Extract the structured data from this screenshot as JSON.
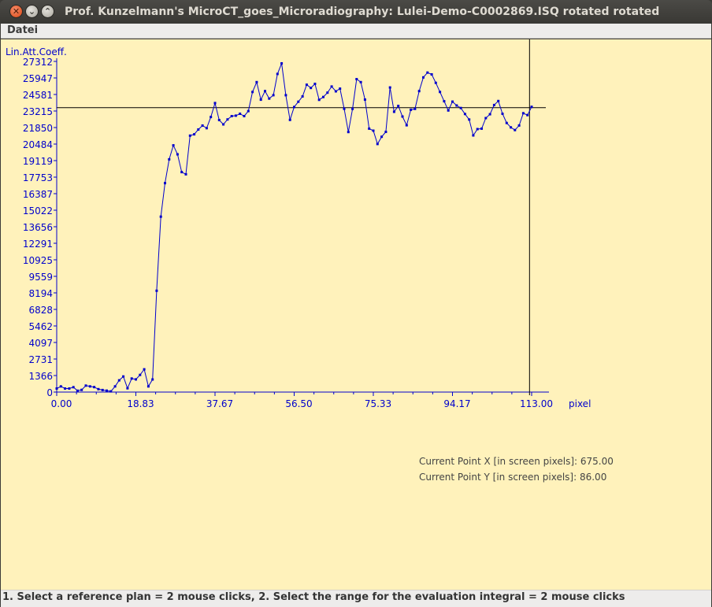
{
  "window": {
    "title": "Prof. Kunzelmann's MicroCT_goes_Microradiography:  Lulei-Demo-C0002869.ISQ rotated rotated"
  },
  "menu": {
    "items": [
      "Datei"
    ]
  },
  "readout": {
    "x_label": "Current Point X [in screen pixels]: 675.00",
    "y_label": "Current Point Y [in screen pixels]: 86.00"
  },
  "status": {
    "text": "1. Select a reference plan = 2 mouse clicks, 2. Select the range for the evaluation integral = 2 mouse clicks"
  },
  "colors": {
    "plot": "#0000cc",
    "background": "#fff2bb",
    "crosshair": "#000000"
  },
  "chart_data": {
    "type": "line",
    "title": "",
    "xlabel": "pixel",
    "ylabel": "Lin.Att.Coeff.",
    "xlim": [
      0,
      113
    ],
    "ylim": [
      0,
      27312
    ],
    "x_ticks": [
      "0.00",
      "18.83",
      "37.67",
      "56.50",
      "75.33",
      "94.17",
      "113.00"
    ],
    "y_ticks": [
      "0",
      "1366",
      "2731",
      "4097",
      "5462",
      "6828",
      "8194",
      "9559",
      "10925",
      "12291",
      "13656",
      "15022",
      "16387",
      "17753",
      "19119",
      "20484",
      "21850",
      "23215",
      "24581",
      "25947",
      "27312"
    ],
    "crosshair": {
      "x": 112.5,
      "y": 23489
    },
    "series": [
      {
        "values": [
          290,
          470,
          290,
          290,
          400,
          110,
          180,
          530,
          470,
          410,
          240,
          170,
          120,
          60,
          470,
          970,
          1290,
          310,
          1120,
          1050,
          1420,
          1880,
          470,
          1040,
          8370,
          14490,
          17260,
          19220,
          20380,
          19640,
          18170,
          17990,
          21180,
          21290,
          21690,
          22010,
          21800,
          22720,
          23870,
          22470,
          22110,
          22520,
          22790,
          22830,
          22990,
          22790,
          23210,
          24790,
          25600,
          24150,
          24860,
          24240,
          24520,
          26280,
          27150,
          24520,
          22480,
          23550,
          23980,
          24420,
          25390,
          25120,
          25460,
          24140,
          24370,
          24730,
          25240,
          24840,
          25060,
          23400,
          21480,
          23390,
          25850,
          25600,
          24160,
          21760,
          21590,
          20490,
          21090,
          21490,
          25160,
          23150,
          23640,
          22760,
          22040,
          23320,
          23390,
          24860,
          25990,
          26390,
          26240,
          25540,
          24790,
          24020,
          23260,
          23990,
          23670,
          23460,
          22970,
          22510,
          21200,
          21720,
          21760,
          22630,
          22950,
          23710,
          24040,
          22990,
          22230,
          21860,
          21640,
          22020,
          23030,
          22880,
          23560
        ]
      }
    ]
  }
}
